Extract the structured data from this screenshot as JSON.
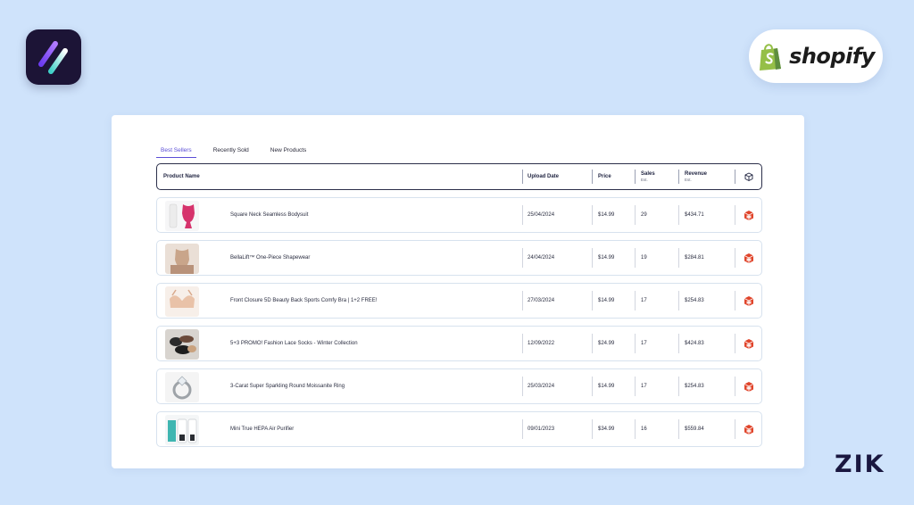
{
  "tabs": [
    {
      "label": "Best Sellers",
      "active": true
    },
    {
      "label": "Recently Sold",
      "active": false
    },
    {
      "label": "New Products",
      "active": false
    }
  ],
  "columns": {
    "product_name": "Product Name",
    "upload_date": "Upload Date",
    "price": "Price",
    "sales": "Sales",
    "sales_sub": "Est.",
    "revenue": "Revenue",
    "revenue_sub": "Est."
  },
  "rows": [
    {
      "name": "Square Neck Seamless Bodysuit",
      "date": "25/04/2024",
      "price": "$14.99",
      "sales": "29",
      "revenue": "$434.71",
      "thumb": "bodysuit"
    },
    {
      "name": "BellaLift™ One-Piece Shapewear",
      "date": "24/04/2024",
      "price": "$14.99",
      "sales": "19",
      "revenue": "$284.81",
      "thumb": "shapewear"
    },
    {
      "name": "Front Closure 5D Beauty Back Sports Comfy Bra | 1+2 FREE!",
      "date": "27/03/2024",
      "price": "$14.99",
      "sales": "17",
      "revenue": "$254.83",
      "thumb": "bra"
    },
    {
      "name": "5+3 PROMO! Fashion Lace Socks - Winter Collection",
      "date": "12/09/2022",
      "price": "$24.99",
      "sales": "17",
      "revenue": "$424.83",
      "thumb": "socks"
    },
    {
      "name": "3-Carat Super Sparkling Round Moissanite Ring",
      "date": "25/03/2024",
      "price": "$14.99",
      "sales": "17",
      "revenue": "$254.83",
      "thumb": "ring"
    },
    {
      "name": "Mini True HEPA Air Purifier",
      "date": "09/01/2023",
      "price": "$34.99",
      "sales": "16",
      "revenue": "$559.84",
      "thumb": "purifier"
    }
  ],
  "branding": {
    "shopify": "shopify",
    "zik": "ZIK"
  },
  "colors": {
    "background": "#cfe3fb",
    "accent": "#5b4ed6",
    "action_icon": "#e0452b",
    "shopify_green": "#95bf47"
  }
}
